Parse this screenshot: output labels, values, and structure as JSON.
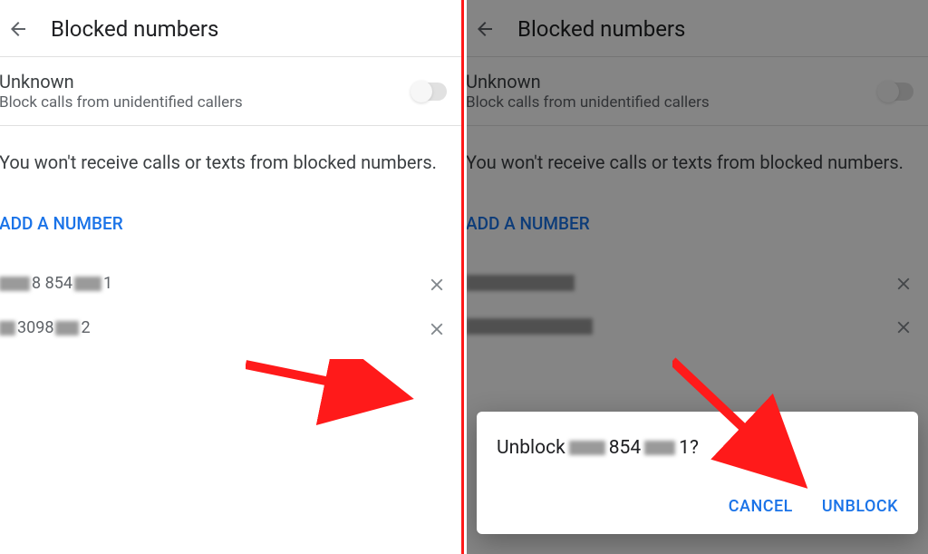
{
  "header": {
    "title": "Blocked numbers"
  },
  "settings": {
    "unknown_title": "Unknown",
    "unknown_subtitle": "Block calls from unidentified callers"
  },
  "info": "You won't receive calls or texts from blocked numbers.",
  "add_number_label": "ADD A NUMBER",
  "numbers": [
    {
      "prefix": "",
      "mid": "8 854",
      "suffix": "1"
    },
    {
      "prefix": "",
      "mid": "3098",
      "suffix": "2"
    }
  ],
  "dialog": {
    "prefix": "Unblock",
    "mid": " 854 ",
    "suffix": "1?",
    "cancel_label": "CANCEL",
    "unblock_label": "UNBLOCK"
  },
  "colors": {
    "accent": "#1a73e8",
    "arrow": "#ff1a1a"
  }
}
